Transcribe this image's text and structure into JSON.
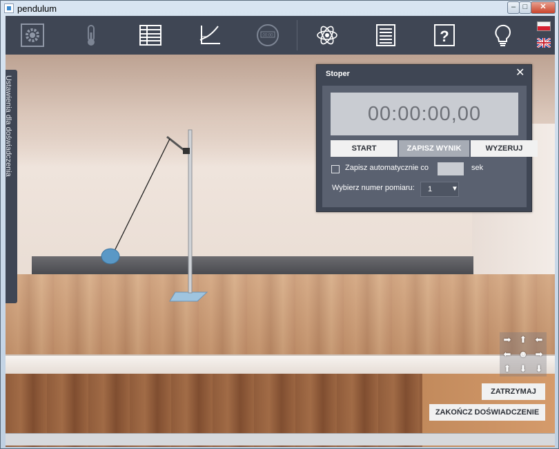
{
  "window": {
    "title": "pendulum",
    "minimize_glyph": "–",
    "maximize_glyph": "□",
    "close_glyph": "✕"
  },
  "toolbar": {
    "items": [
      {
        "icon": "gear-icon"
      },
      {
        "icon": "thermometer-icon"
      },
      {
        "icon": "table-icon"
      },
      {
        "icon": "chart-icon"
      },
      {
        "icon": "stopwatch-icon",
        "label": "00:00"
      },
      {
        "icon": "atom-icon"
      },
      {
        "icon": "document-icon"
      },
      {
        "icon": "help-icon",
        "label": "?"
      },
      {
        "icon": "lightbulb-icon"
      }
    ],
    "languages": [
      "pl-flag-icon",
      "uk-flag-icon"
    ]
  },
  "sidebar": {
    "tab_label": "Ustawienia dla doświadczenia"
  },
  "stopwatch": {
    "title": "Stoper",
    "close_glyph": "✕",
    "display": "00:00:00,00",
    "start_label": "START",
    "save_label": "ZAPISZ WYNIK",
    "reset_label": "WYZERUJ",
    "auto_save_label": "Zapisz automatycznie co",
    "auto_save_value": "",
    "auto_save_unit": "sek",
    "measurement_label": "Wybierz numer pomiaru:",
    "measurement_value": "1"
  },
  "navigation": {
    "glyphs": [
      "➡",
      "⬆",
      "⬅",
      "⬅",
      "",
      "➡",
      "⬆",
      "⬇",
      "⬇"
    ]
  },
  "actions": {
    "pause_label": "ZATRZYMAJ",
    "end_label": "ZAKOŃCZ DOŚWIADCZENIE"
  },
  "colors": {
    "toolbar": "#3f4654",
    "panel": "#3f4654",
    "panel_inner": "#5a6170",
    "display_bg": "#c9ccd2"
  }
}
